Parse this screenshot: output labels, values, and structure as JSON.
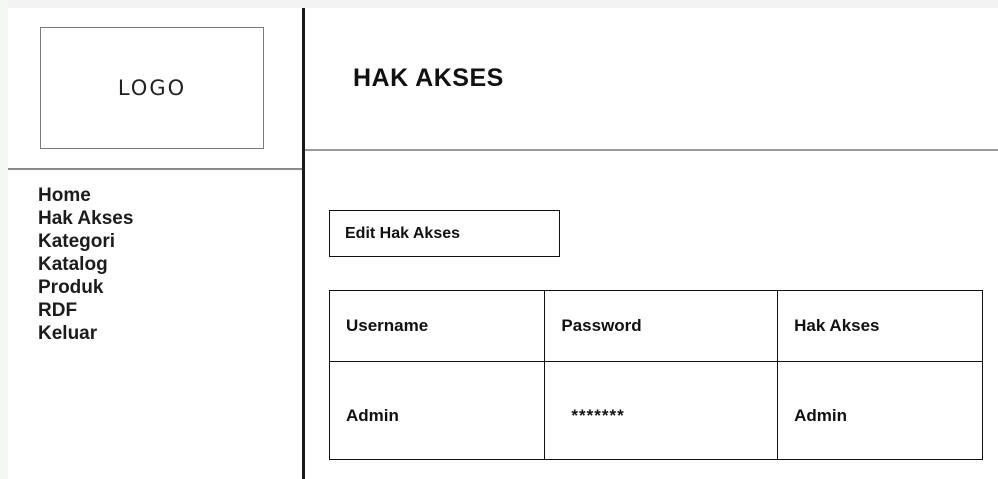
{
  "sidebar": {
    "logo_text": "LOGO",
    "nav_items": [
      {
        "label": "Home"
      },
      {
        "label": "Hak Akses"
      },
      {
        "label": "Kategori"
      },
      {
        "label": "Katalog"
      },
      {
        "label": "Produk"
      },
      {
        "label": "RDF"
      },
      {
        "label": "Keluar"
      }
    ]
  },
  "header": {
    "title": "HAK AKSES"
  },
  "main": {
    "edit_button_label": "Edit Hak Akses",
    "table": {
      "columns": [
        "Username",
        "Password",
        "Hak Akses"
      ],
      "rows": [
        [
          "Admin",
          "*******",
          "Admin"
        ]
      ]
    }
  }
}
